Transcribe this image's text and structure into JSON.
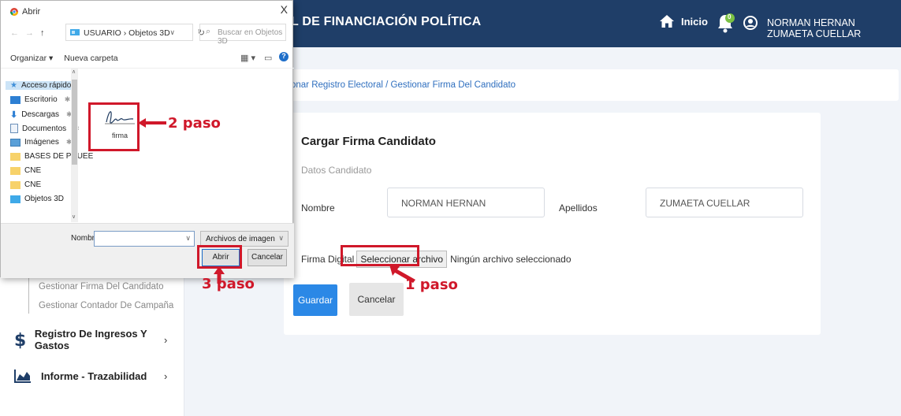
{
  "header": {
    "title": "L DE FINANCIACIÓN POLÍTICA",
    "home_label": "Inicio",
    "notification_count": "0",
    "username": "NORMAN HERNAN ZUMAETA CUELLAR"
  },
  "sidebar": {
    "sub_items": [
      {
        "label": "Gestionar Firma Del Candidato"
      },
      {
        "label": "Gestionar Contador De Campaña"
      }
    ],
    "menu_items": [
      {
        "label": "Registro De Ingresos Y Gastos",
        "icon": "dollar-icon"
      },
      {
        "label": "Informe - Trazabilidad",
        "icon": "chart-area-icon"
      }
    ]
  },
  "breadcrumb": {
    "text": "onar Registro Electoral / Gestionar Firma Del Candidato"
  },
  "form": {
    "title": "Cargar Firma Candidato",
    "subtitle": "Datos Candidato",
    "nombre_label": "Nombre",
    "nombre_value": "NORMAN HERNAN",
    "apellidos_label": "Apellidos",
    "apellidos_value": "ZUMAETA CUELLAR",
    "firma_label": "Firma Digital",
    "file_button": "Seleccionar archivo",
    "file_status": "Ningún archivo seleccionado",
    "save_button": "Guardar",
    "cancel_button": "Cancelar"
  },
  "annotations": {
    "step1": "1 paso",
    "step2": "2 paso",
    "step3": "3 paso",
    "color": "#d0182a"
  },
  "dialog": {
    "title": "Abrir",
    "close": "X",
    "path": "USUARIO › Objetos 3D",
    "search_placeholder": "Buscar en Objetos 3D",
    "organize": "Organizar ▾",
    "new_folder": "Nueva carpeta",
    "nav_items": [
      {
        "label": "Acceso rápido",
        "icon": "star-icon"
      },
      {
        "label": "Escritorio",
        "icon": "desktop-icon"
      },
      {
        "label": "Descargas",
        "icon": "download-icon"
      },
      {
        "label": "Documentos",
        "icon": "document-icon"
      },
      {
        "label": "Imágenes",
        "icon": "image-icon"
      },
      {
        "label": "BASES DE PRUEE",
        "icon": "folder-icon"
      },
      {
        "label": "CNE",
        "icon": "folder-icon"
      },
      {
        "label": "CNE",
        "icon": "folder-icon"
      },
      {
        "label": "Objetos 3D",
        "icon": "objects3d-icon"
      }
    ],
    "file_name": "firma",
    "name_label": "Nombre:",
    "name_value": "",
    "file_type": "Archivos de imagen",
    "open_button": "Abrir",
    "cancel_button": "Cancelar"
  },
  "colors": {
    "header_bg": "#1f3e68",
    "primary_button": "#2b88e6",
    "breadcrumb_link": "#2f6fbf",
    "notification_badge": "#7ac143"
  }
}
